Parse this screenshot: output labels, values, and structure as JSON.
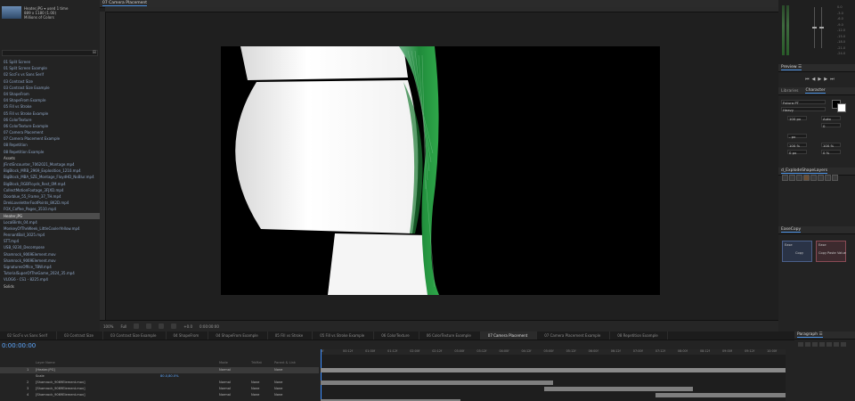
{
  "project": {
    "file_name": "Heater.jPG ▾ used 1 time",
    "file_dims": "889 x 1180 (1.00)",
    "file_color": "Millions of Colors",
    "items": [
      {
        "label": "01 Split Screen",
        "type": "comp"
      },
      {
        "label": "01 Split Screen Example",
        "type": "comp"
      },
      {
        "label": "02 SccFx vs Sans Serif",
        "type": "comp"
      },
      {
        "label": "03 Contrast Size",
        "type": "comp"
      },
      {
        "label": "03 Contrast Size Example",
        "type": "comp"
      },
      {
        "label": "04 ShapeFrom",
        "type": "comp"
      },
      {
        "label": "04 ShapeFrom Example",
        "type": "comp"
      },
      {
        "label": "05 Fill vs Stroke",
        "type": "comp"
      },
      {
        "label": "05 Fill vs Stroke Example",
        "type": "comp"
      },
      {
        "label": "06 ColorTexture",
        "type": "comp"
      },
      {
        "label": "06 ColorTexture Example",
        "type": "comp"
      },
      {
        "label": "07 Camera Placement",
        "type": "comp"
      },
      {
        "label": "07 Camera Placement Example",
        "type": "comp"
      },
      {
        "label": "08 Repetition",
        "type": "comp"
      },
      {
        "label": "08 Repetition Example",
        "type": "comp"
      },
      {
        "label": "Assets",
        "type": "folder"
      },
      {
        "label": "JFirstEncounter_7062021_Montage.mp4",
        "type": "file"
      },
      {
        "label": "BigBlock_MRB_2969_Explosition_1210.mp4",
        "type": "file"
      },
      {
        "label": "BigBlock_MBA_SZE_Montage_FloydHD_NoBlur.mp4",
        "type": "file"
      },
      {
        "label": "BigBlock_RGBFloyds_Rest_0M.mp4",
        "type": "file"
      },
      {
        "label": "CollectMotionFootage_3FJXD.mp4",
        "type": "file"
      },
      {
        "label": "Doorblue_55_Frame_37_TH.mp4",
        "type": "file"
      },
      {
        "label": "DrekLoveletterFootPoints_8K2D.mp4",
        "type": "file"
      },
      {
        "label": "FOX_Coffee_Pages_3510.mp4",
        "type": "file"
      },
      {
        "label": "Heater.jPG",
        "type": "file",
        "selected": true
      },
      {
        "label": "LocalBirds_04.mp4",
        "type": "file"
      },
      {
        "label": "MonkeyOfTheWeek_LittleCoolerYellow.mp4",
        "type": "file"
      },
      {
        "label": "PennantBall_3025.mp4",
        "type": "file"
      },
      {
        "label": "STT.mp4",
        "type": "file"
      },
      {
        "label": "USB_9230_Decompose",
        "type": "file"
      },
      {
        "label": "Shamrock_9069Element.mov",
        "type": "file"
      },
      {
        "label": "Shamrock_9069Element.mov",
        "type": "file"
      },
      {
        "label": "SignaturesOffice_TBW.mp4",
        "type": "file"
      },
      {
        "label": "TutorialSuperOfTheGame_2024_35.mp4",
        "type": "file"
      },
      {
        "label": "VLOG6 - CS1 - 8225.mp4",
        "type": "file"
      },
      {
        "label": "Solids",
        "type": "folder"
      }
    ]
  },
  "viewer": {
    "tab_label": "07 Camera Placement",
    "zoom": "100%",
    "resolution": "Full",
    "timecode": "0:00:00:00",
    "exposure": "+0.0"
  },
  "info": {
    "db_labels": [
      "0.0",
      "-3.0",
      "-6.0",
      "-9.0",
      "-12.0",
      "-15.0",
      "-18.0",
      "-21.0",
      "-24.0"
    ]
  },
  "preview": {
    "title": "Preview ☰"
  },
  "character": {
    "tabs": [
      "Libraries",
      "Character"
    ],
    "font": "Futura PT",
    "style": "Heavy",
    "size": "100 px",
    "leading": "Auto",
    "tracking": "0",
    "stroke": "- px",
    "vscale": "100 %",
    "hscale": "100 %",
    "baseline": "0 px",
    "tsume": "0 %",
    "fill_color": "#000000",
    "stroke_color": "#ffffff"
  },
  "effects": {
    "title": "d_ExplodeShapeLayers"
  },
  "essential": {
    "title": "EaseCopy",
    "tile1_labels": [
      "Ease",
      "Copy"
    ],
    "tile2_labels": [
      "Ease",
      "Copy",
      "Paste",
      "Value"
    ]
  },
  "timeline": {
    "timecode": "0:00:00:00",
    "tabs": [
      {
        "label": "02 SccFx vs Sans Serif",
        "active": false
      },
      {
        "label": "03 Contrast Size",
        "active": false
      },
      {
        "label": "03 Contrast Size Example",
        "active": false
      },
      {
        "label": "04 ShapeFrom",
        "active": false
      },
      {
        "label": "04 ShapeFrom Example",
        "active": false
      },
      {
        "label": "05 Fill vs Stroke",
        "active": false
      },
      {
        "label": "05 Fill vs Stroke Example",
        "active": false
      },
      {
        "label": "06 ColorTexture",
        "active": false
      },
      {
        "label": "06 ColorTexture Example",
        "active": false
      },
      {
        "label": "07 Camera Placement",
        "active": true
      },
      {
        "label": "07 Camera Placement Example",
        "active": false
      },
      {
        "label": "08 Repetition Example",
        "active": false
      }
    ],
    "col_layer_name": "Layer Name",
    "col_mode": "Mode",
    "col_trkmat": "TrkMat",
    "col_parent": "Parent & Link",
    "layers": [
      {
        "num": "1",
        "name": "[Heater.jPG]",
        "mode": "Normal",
        "trk": "",
        "parent": "None",
        "selected": true
      },
      {
        "num": "",
        "name": "Scale",
        "mode": "",
        "trk": "",
        "parent": "",
        "selected": false,
        "value": "80.0,80.0%"
      },
      {
        "num": "2",
        "name": "[Shamrock_9069Element.mov]",
        "mode": "Normal",
        "trk": "None",
        "parent": "None",
        "selected": false
      },
      {
        "num": "3",
        "name": "[Shamrock_9069Element.mov]",
        "mode": "Normal",
        "trk": "None",
        "parent": "None",
        "selected": false
      },
      {
        "num": "4",
        "name": "[Shamrock_9069Element.mov]",
        "mode": "Normal",
        "trk": "None",
        "parent": "None",
        "selected": false
      }
    ],
    "ruler_labels": [
      "0f",
      "00:12f",
      "01:00f",
      "01:12f",
      "02:00f",
      "02:12f",
      "03:00f",
      "03:12f",
      "04:00f",
      "04:12f",
      "05:00f",
      "05:12f",
      "06:00f",
      "06:12f",
      "07:00f",
      "07:12f",
      "08:00f",
      "08:12f",
      "09:00f",
      "09:12f",
      "10:00f"
    ],
    "bars": [
      {
        "row": 0,
        "start": 0.0,
        "end": 1.0
      },
      {
        "row": 2,
        "start": 0.0,
        "end": 0.5
      },
      {
        "row": 3,
        "start": 0.48,
        "end": 0.8
      },
      {
        "row": 4,
        "start": 0.72,
        "end": 1.0
      },
      {
        "row": 5,
        "start": 0.0,
        "end": 0.3
      }
    ]
  },
  "paragraph": {
    "title": "Paragraph ☰"
  }
}
